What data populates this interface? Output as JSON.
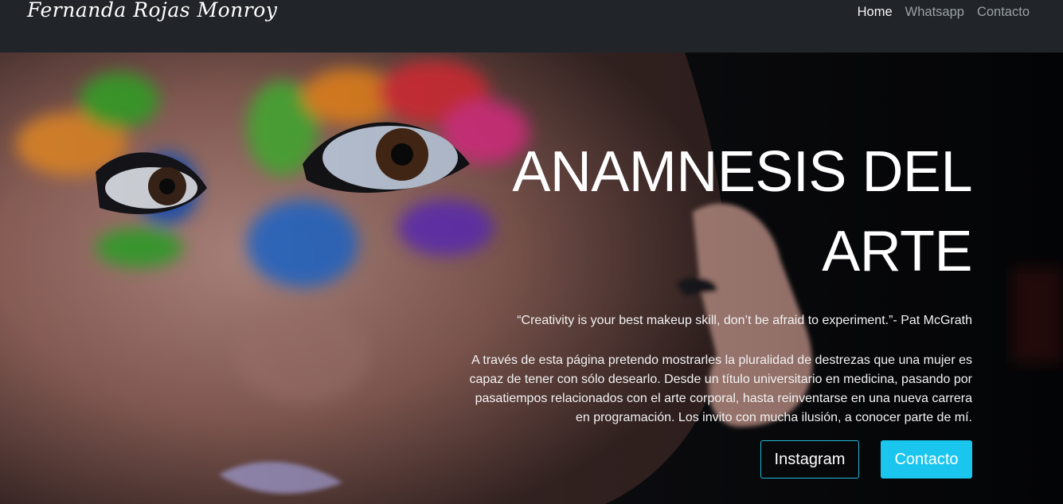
{
  "navbar": {
    "brand": "Fernanda Rojas Monroy",
    "links": [
      {
        "label": "Home",
        "active": true
      },
      {
        "label": "Whatsapp",
        "active": false
      },
      {
        "label": "Contacto",
        "active": false
      }
    ]
  },
  "hero": {
    "title_line1": "ANAMNESIS DEL",
    "title_line2": "ARTE",
    "quote": "“Creativity is your best makeup skill, don’t be afraid to experiment.”- Pat McGrath",
    "intro": "A través de esta página pretendo mostrarles la pluralidad de destrezas que una mujer es capaz de tener con sólo desearlo. Desde un título universitario en medicina, pasando por pasatiempos relacionados con el arte corporal, hasta reinventarse en una nueva carrera en programación. Los invito con mucha ilusión, a conocer parte de mí.",
    "buttons": {
      "instagram": "Instagram",
      "contacto": "Contacto"
    }
  },
  "colors": {
    "navbar_bg": "#212529",
    "accent": "#1bc6ee",
    "outline": "#22b8d4"
  }
}
